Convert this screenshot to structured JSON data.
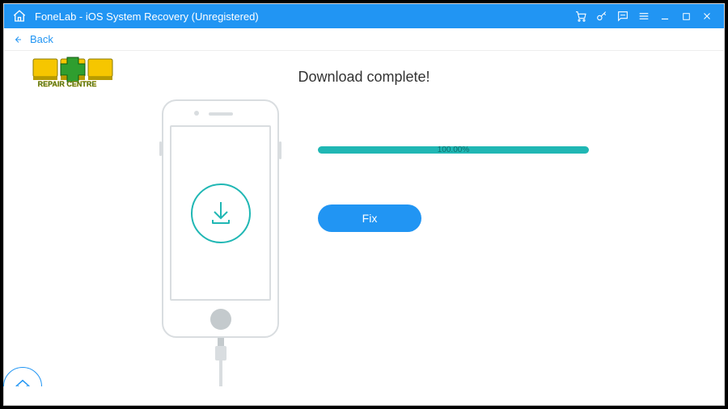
{
  "app": {
    "title": "FoneLab - iOS System Recovery (Unregistered)"
  },
  "nav": {
    "back_label": "Back"
  },
  "main": {
    "heading": "Download complete!",
    "progress_percent": "100.00%",
    "fix_label": "Fix"
  },
  "watermark": {
    "text": "REPAIR CENTRE"
  },
  "colors": {
    "accent": "#2195f3",
    "teal": "#20b7b4"
  }
}
